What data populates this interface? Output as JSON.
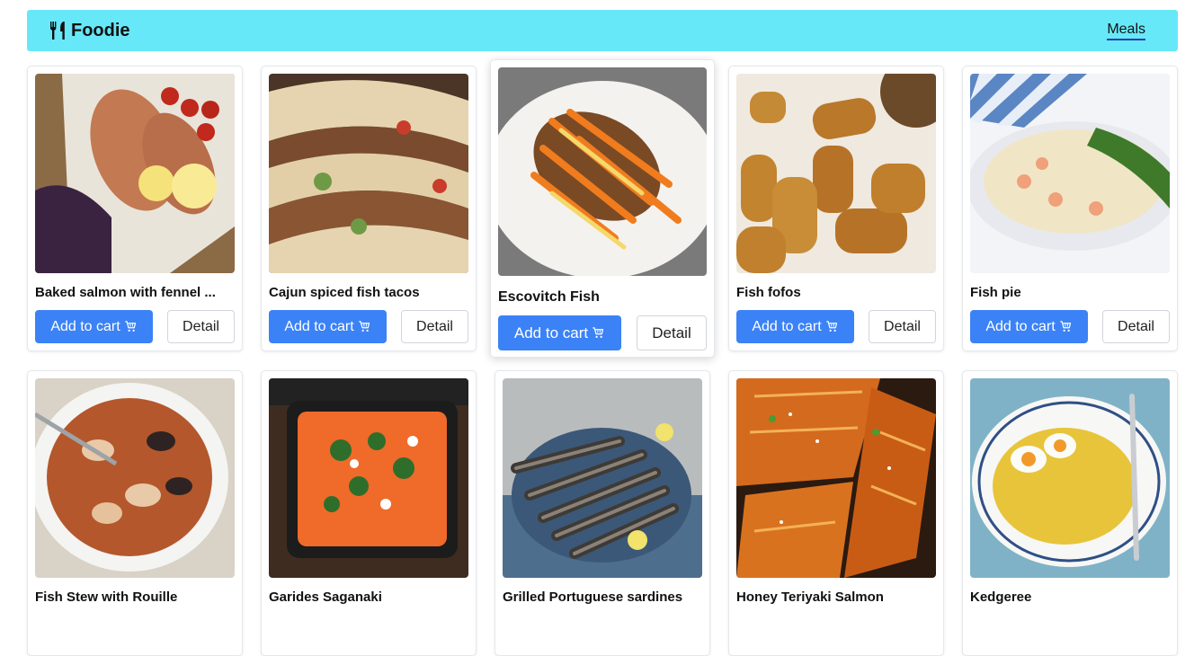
{
  "brand": {
    "name": "Foodie",
    "icon": "fork-knife-icon"
  },
  "nav": {
    "meals_label": "Meals"
  },
  "buttons": {
    "add_to_cart": "Add to cart",
    "detail": "Detail",
    "cart_icon": "cart-icon"
  },
  "meals": [
    {
      "title": "Baked salmon with fennel ..."
    },
    {
      "title": "Cajun spiced fish tacos"
    },
    {
      "title": "Escovitch Fish"
    },
    {
      "title": "Fish fofos"
    },
    {
      "title": "Fish pie"
    },
    {
      "title": "Fish Stew with Rouille"
    },
    {
      "title": "Garides Saganaki"
    },
    {
      "title": "Grilled Portuguese sardines"
    },
    {
      "title": "Honey Teriyaki Salmon"
    },
    {
      "title": "Kedgeree"
    }
  ],
  "colors": {
    "navbar": "#67e8f9",
    "primary": "#3b82f6"
  }
}
